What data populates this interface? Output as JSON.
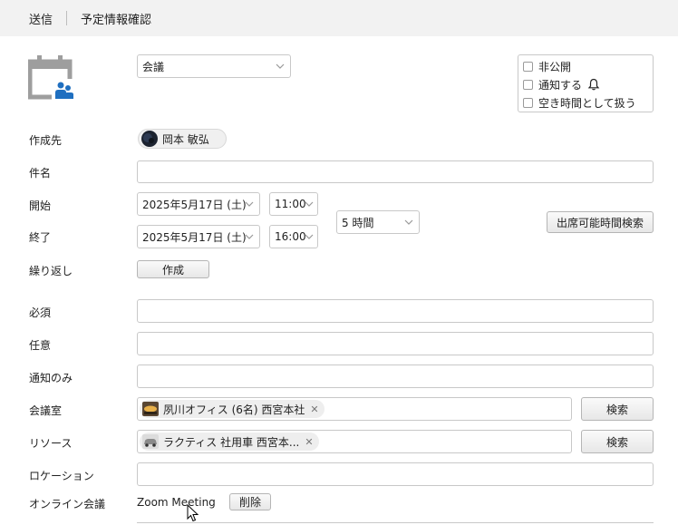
{
  "header": {
    "tabs": [
      {
        "label": "送信"
      },
      {
        "label": "予定情報確認"
      }
    ]
  },
  "event_type": {
    "value": "会議"
  },
  "options": {
    "private": "非公開",
    "notify": "通知する",
    "free_time": "空き時間として扱う"
  },
  "form": {
    "creator": {
      "label": "作成先",
      "name": "岡本 敏弘"
    },
    "subject": {
      "label": "件名",
      "value": ""
    },
    "start": {
      "label": "開始",
      "date": "2025年5月17日 (土)",
      "time": "11:00"
    },
    "end": {
      "label": "終了",
      "date": "2025年5月17日 (土)",
      "time": "16:00"
    },
    "duration": "5 時間",
    "find_time_button": "出席可能時間検索",
    "repeat": {
      "label": "繰り返し",
      "button": "作成"
    },
    "required": {
      "label": "必須",
      "value": ""
    },
    "optional": {
      "label": "任意",
      "value": ""
    },
    "notify_only": {
      "label": "通知のみ",
      "value": ""
    },
    "room": {
      "label": "会議室",
      "chip": "夙川オフィス (6名) 西宮本社",
      "search": "検索"
    },
    "resource": {
      "label": "リソース",
      "chip": "ラクティス 社用車 西宮本...",
      "search": "検索"
    },
    "location": {
      "label": "ロケーション",
      "value": ""
    },
    "online": {
      "label": "オンライン会議",
      "value": "Zoom Meeting",
      "delete": "削除"
    }
  },
  "colors": {
    "icon_gray": "#9e9e9e",
    "icon_blue": "#1f6fc0",
    "header_bg": "#f2f2f2"
  }
}
